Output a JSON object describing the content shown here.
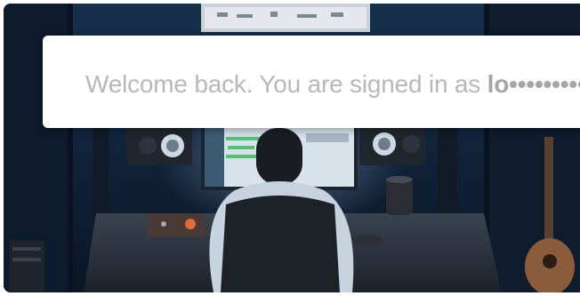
{
  "banner": {
    "message": "Welcome back. You are signed in as ",
    "username_masked": "lo••••••••••"
  },
  "scene": {
    "image_description_icon": "music-studio-photo-icon"
  },
  "colors": {
    "banner_bg": "#ffffff",
    "banner_text": "#b8b8b8",
    "scene_bg": "#0d1828"
  }
}
